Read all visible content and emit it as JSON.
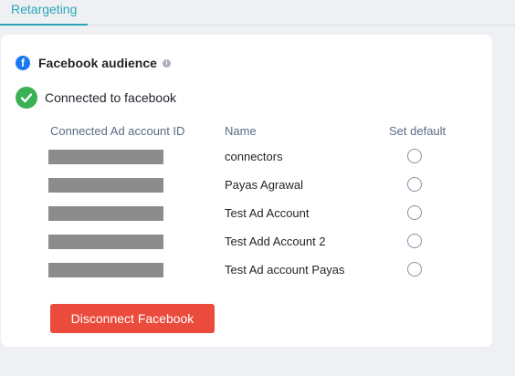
{
  "tabs": [
    {
      "label": "Retargeting",
      "active": true
    }
  ],
  "card": {
    "title": "Facebook audience",
    "facebook_icon_glyph": "f",
    "info_icon": "info-icon",
    "status_text": "Connected to facebook",
    "status_icon": "check-circle-icon"
  },
  "table": {
    "headers": {
      "account_id": "Connected Ad account ID",
      "name": "Name",
      "default": "Set default"
    },
    "rows": [
      {
        "name": "connectors",
        "selected": false
      },
      {
        "name": "Payas Agrawal",
        "selected": false
      },
      {
        "name": "Test Ad Account",
        "selected": false
      },
      {
        "name": "Test Add Account 2",
        "selected": false
      },
      {
        "name": "Test Ad account Payas",
        "selected": false
      }
    ]
  },
  "actions": {
    "disconnect_label": "Disconnect Facebook"
  },
  "colors": {
    "accent": "#2aa6b8",
    "facebook_blue": "#1877f2",
    "success_green": "#3bb054",
    "danger_red": "#ea4b3c"
  }
}
